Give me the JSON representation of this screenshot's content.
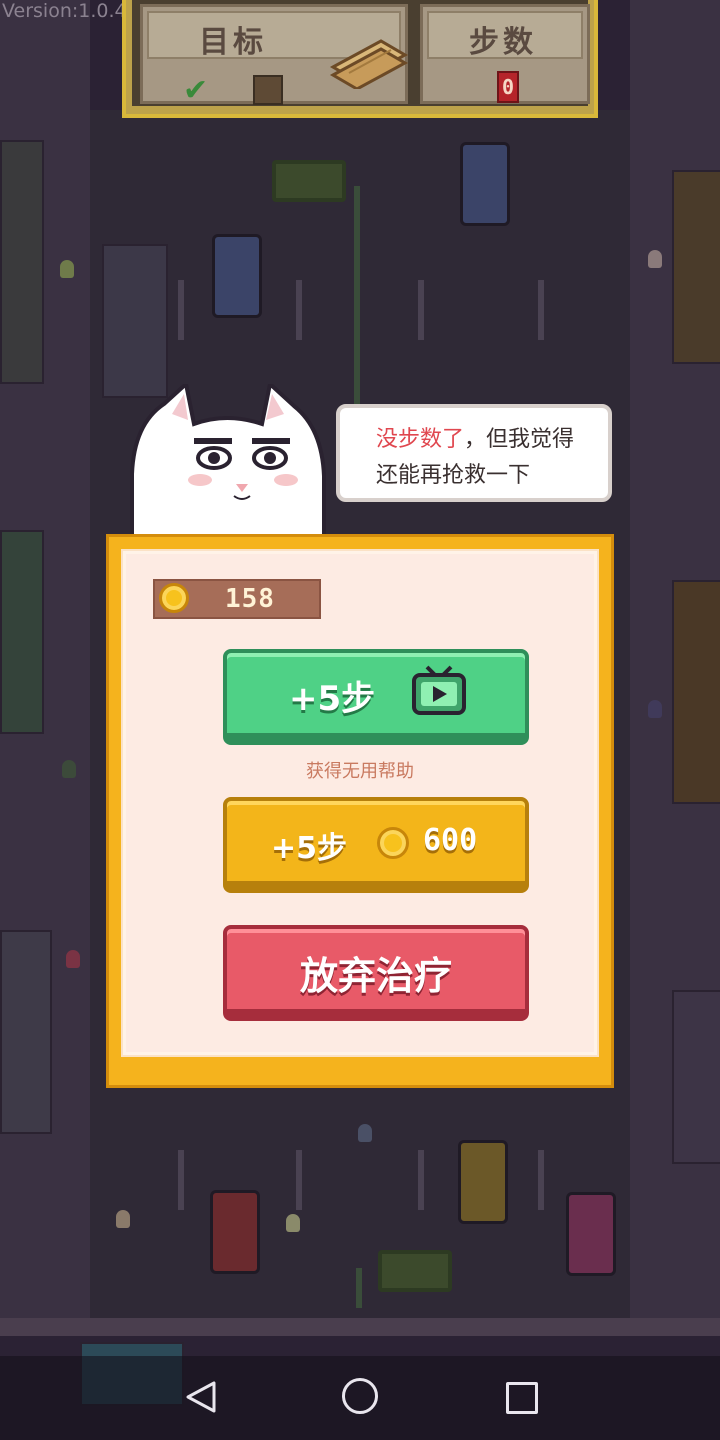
{
  "version": "Version:1.0.4",
  "hud": {
    "goal_title": "目标",
    "steps_title": "步数",
    "goal_check": "✔",
    "steps_value": "0"
  },
  "speech": {
    "highlight": "没步数了",
    "rest": "，但我觉得还能再抢救一下"
  },
  "dialog": {
    "coins": "158",
    "watch_ad_button": "+5步",
    "watch_ad_hint": "获得无用帮助",
    "buy_button": "+5步",
    "buy_price": "600",
    "give_up_button": "放弃治疗"
  },
  "colors": {
    "green_button": "#4fd186",
    "yellow_button": "#f3b51a",
    "red_button": "#e85a68",
    "dialog_frame": "#f5b31d",
    "highlight_text": "#e0474f"
  },
  "icons": {
    "goal_item": "wood-planks-icon",
    "video_ad": "tv-play-icon",
    "currency": "coin-icon",
    "nav_back": "back-triangle-icon",
    "nav_home": "home-circle-icon",
    "nav_recent": "recent-square-icon"
  }
}
